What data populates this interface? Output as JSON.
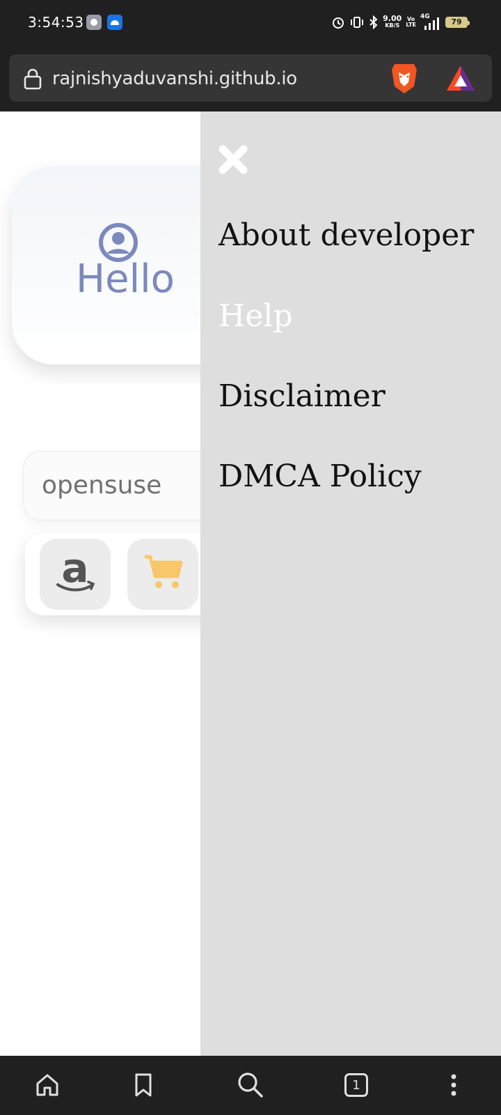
{
  "status_bar": {
    "time": "3:54:53",
    "net_speed_value": "9.00",
    "net_speed_unit": "KB/S",
    "volte_top": "Vo",
    "volte_bottom": "LTE",
    "network_type": "4G",
    "battery_level": "79",
    "icons": [
      "settings-notification-icon",
      "android-notification-icon",
      "alarm-icon",
      "vibrate-icon",
      "bluetooth-icon",
      "signal-icon",
      "battery-icon"
    ]
  },
  "browser": {
    "url": "rajnishyaduvanshi.github.io",
    "icons": [
      "lock-icon",
      "brave-shields-icon",
      "brave-rewards-icon"
    ]
  },
  "page": {
    "greeting": "Hello",
    "search_value": "opensuse",
    "shortcuts": [
      "amazon-icon",
      "cart-icon"
    ],
    "colors": {
      "greeting": "#7b89bd",
      "cart": "#f7c76a"
    }
  },
  "drawer": {
    "items": [
      {
        "label": "About developer"
      },
      {
        "label": "Help"
      },
      {
        "label": "Disclaimer"
      },
      {
        "label": "DMCA Policy"
      }
    ],
    "colors": {
      "background": "#dedede",
      "active_item": "#ffffff",
      "item": "#111111"
    }
  },
  "bottom_bar": {
    "tab_count": "1",
    "icons": [
      "home-icon",
      "bookmark-icon",
      "search-icon",
      "tabs-icon",
      "more-icon"
    ]
  }
}
